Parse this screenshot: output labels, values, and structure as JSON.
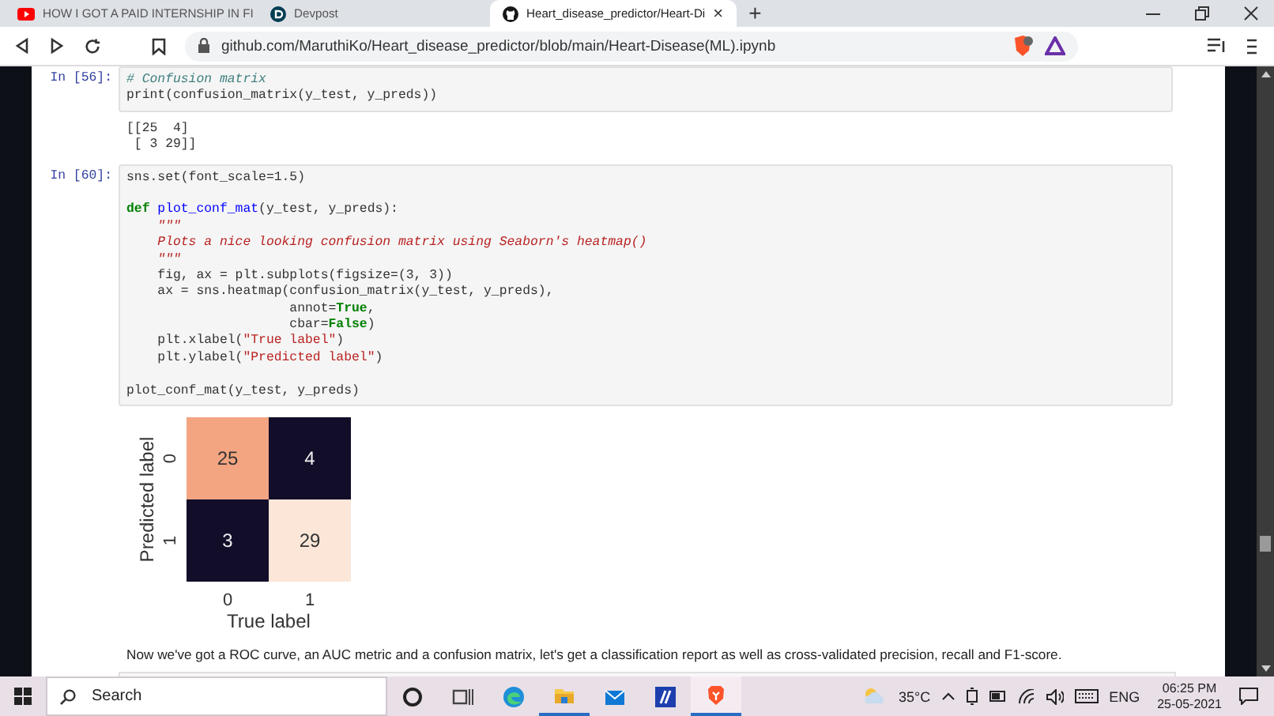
{
  "browser": {
    "tabs": [
      {
        "title": "HOW I GOT A PAID INTERNSHIP IN FI",
        "selected": false
      },
      {
        "title": "Devpost",
        "selected": false
      },
      {
        "title": "Heart_disease_predictor/Heart-Di",
        "selected": true
      }
    ],
    "close_glyph": "×",
    "new_tab_glyph": "+",
    "url": "github.com/MaruthiKo/Heart_disease_predictor/blob/main/Heart-Disease(ML).ipynb"
  },
  "notebook": {
    "cells": [
      {
        "prompt": "In [56]:",
        "code": [
          {
            "kind": "code",
            "tokens": [
              {
                "kind": "comment",
                "text": "# Confusion matrix"
              }
            ]
          },
          {
            "kind": "code",
            "tokens": [
              {
                "kind": "plain",
                "text": "print(confusion_matrix(y_test, y_preds))"
              }
            ]
          }
        ],
        "output": [
          "[[25  4]",
          " [ 3 29]]"
        ]
      },
      {
        "prompt": "In [60]:",
        "code": [
          {
            "kind": "code",
            "tokens": [
              {
                "kind": "plain",
                "text": "sns.set(font_scale=1.5)"
              }
            ]
          },
          {
            "kind": "blank"
          },
          {
            "kind": "code",
            "tokens": [
              {
                "kind": "keyword",
                "text": "def "
              },
              {
                "kind": "function",
                "text": "plot_conf_mat"
              },
              {
                "kind": "plain",
                "text": "(y_test, y_preds):"
              }
            ]
          },
          {
            "kind": "code",
            "tokens": [
              {
                "kind": "docstring",
                "text": "    \"\"\""
              }
            ]
          },
          {
            "kind": "code",
            "tokens": [
              {
                "kind": "docstring",
                "text": "    Plots a nice looking confusion matrix using Seaborn's heatmap()"
              }
            ]
          },
          {
            "kind": "code",
            "tokens": [
              {
                "kind": "docstring",
                "text": "    \"\"\""
              }
            ]
          },
          {
            "kind": "code",
            "tokens": [
              {
                "kind": "plain",
                "text": "    fig, ax = plt.subplots(figsize=(3, 3))"
              }
            ]
          },
          {
            "kind": "code",
            "tokens": [
              {
                "kind": "plain",
                "text": "    ax = sns.heatmap(confusion_matrix(y_test, y_preds),"
              }
            ]
          },
          {
            "kind": "code",
            "tokens": [
              {
                "kind": "plain",
                "text": "                     annot="
              },
              {
                "kind": "keyword",
                "text": "True"
              },
              {
                "kind": "plain",
                "text": ","
              }
            ]
          },
          {
            "kind": "code",
            "tokens": [
              {
                "kind": "plain",
                "text": "                     cbar="
              },
              {
                "kind": "keyword",
                "text": "False"
              },
              {
                "kind": "plain",
                "text": ")"
              }
            ]
          },
          {
            "kind": "code",
            "tokens": [
              {
                "kind": "plain",
                "text": "    plt.xlabel("
              },
              {
                "kind": "string",
                "text": "\"True label\""
              },
              {
                "kind": "plain",
                "text": ")"
              }
            ]
          },
          {
            "kind": "code",
            "tokens": [
              {
                "kind": "plain",
                "text": "    plt.ylabel("
              },
              {
                "kind": "string",
                "text": "\"Predicted label\""
              },
              {
                "kind": "plain",
                "text": ")"
              }
            ]
          },
          {
            "kind": "blank"
          },
          {
            "kind": "code",
            "tokens": [
              {
                "kind": "plain",
                "text": "plot_conf_mat(y_test, y_preds)"
              }
            ]
          }
        ],
        "heatmap": {
          "xlabel": "True label",
          "ylabel": "Predicted label",
          "xticks": [
            "0",
            "1"
          ],
          "yticks": [
            "0",
            "1"
          ],
          "cells": [
            {
              "value": "25",
              "color": "#f3a582"
            },
            {
              "value": "4",
              "color": "#120d29"
            },
            {
              "value": "3",
              "color": "#120d29"
            },
            {
              "value": "29",
              "color": "#fbe6d8"
            }
          ]
        }
      }
    ],
    "markdown": "Now we've got a ROC curve, an AUC metric and a confusion matrix, let's get a classification report as well as cross-validated precision, recall and F1-score."
  },
  "taskbar": {
    "search_placeholder": "Search",
    "apps": [
      {
        "kind": "cortana",
        "running": false,
        "selected": false
      },
      {
        "kind": "taskview",
        "running": false,
        "selected": false
      },
      {
        "kind": "edge",
        "running": false,
        "selected": false
      },
      {
        "kind": "folder",
        "running": true,
        "selected": false
      },
      {
        "kind": "mail",
        "running": false,
        "selected": false
      },
      {
        "kind": "app",
        "running": false,
        "selected": false
      },
      {
        "kind": "brave",
        "running": true,
        "selected": true
      }
    ],
    "temperature": "35°C",
    "language": "ENG",
    "time": "06:25 PM",
    "date": "25-05-2021"
  }
}
